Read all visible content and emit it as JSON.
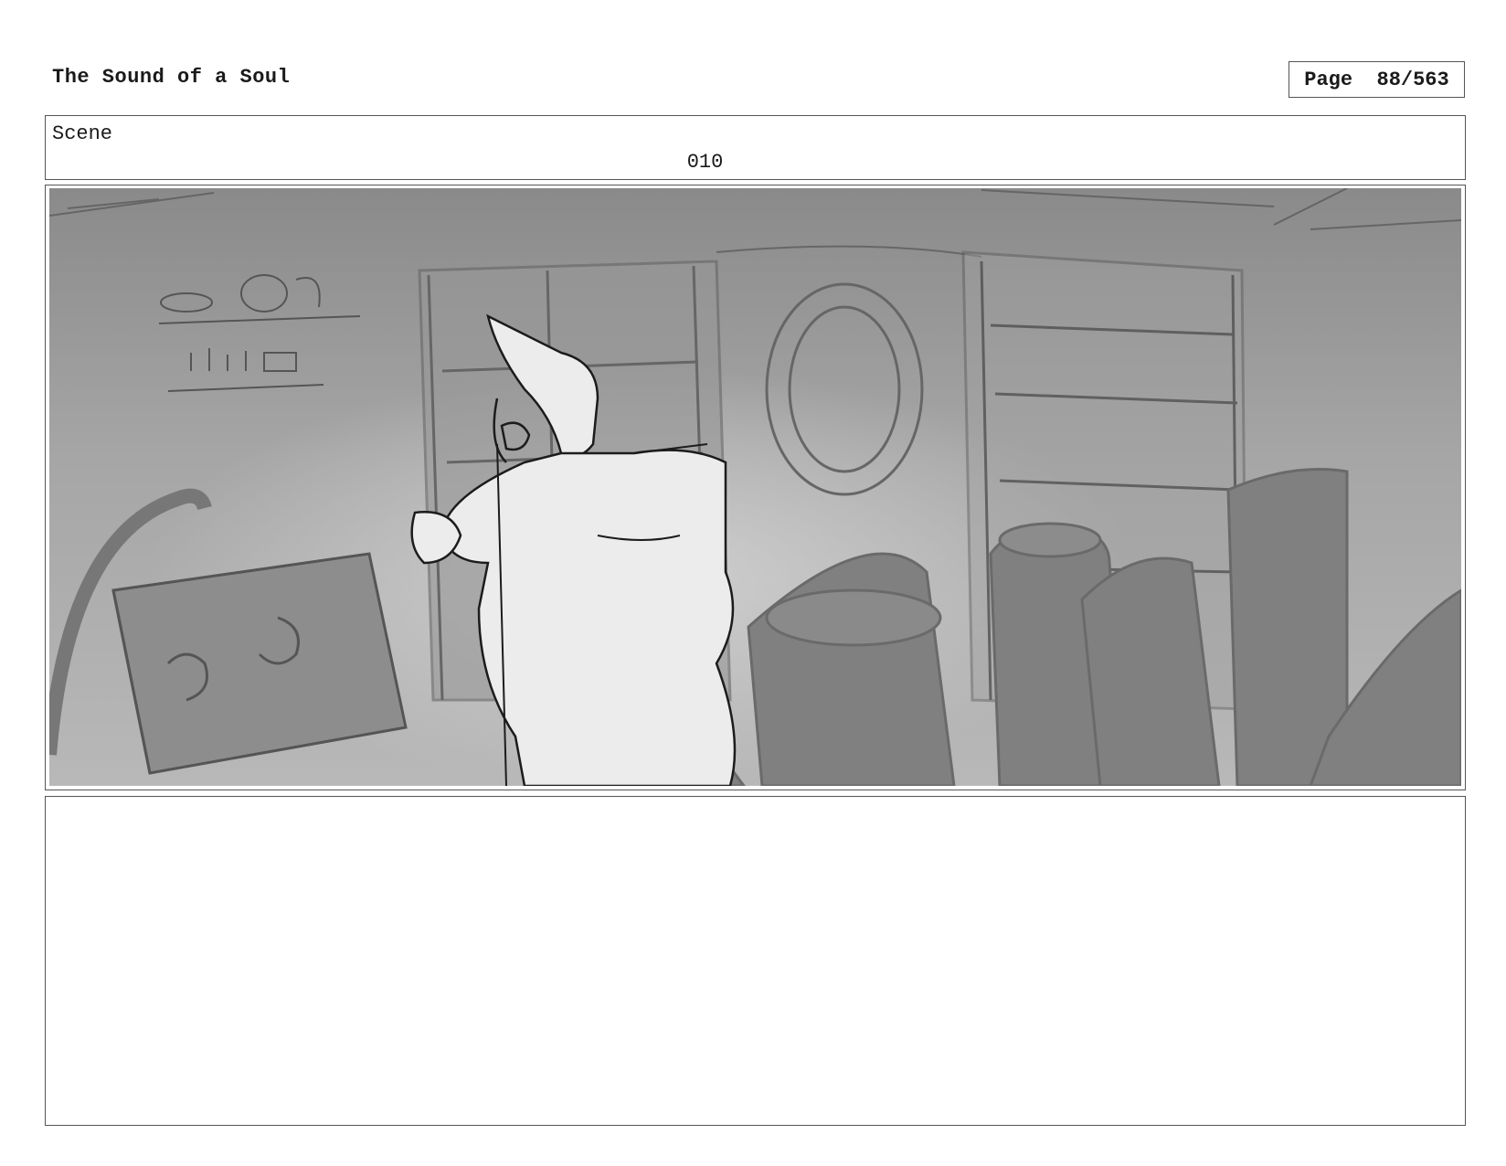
{
  "header": {
    "title": "The Sound of a Soul",
    "page_label": "Page  88/563"
  },
  "scene": {
    "label": "Scene",
    "number": "010"
  },
  "panel": {
    "image_description_icon": "storyboard-sketch-icon"
  },
  "notes": {
    "text": ""
  }
}
